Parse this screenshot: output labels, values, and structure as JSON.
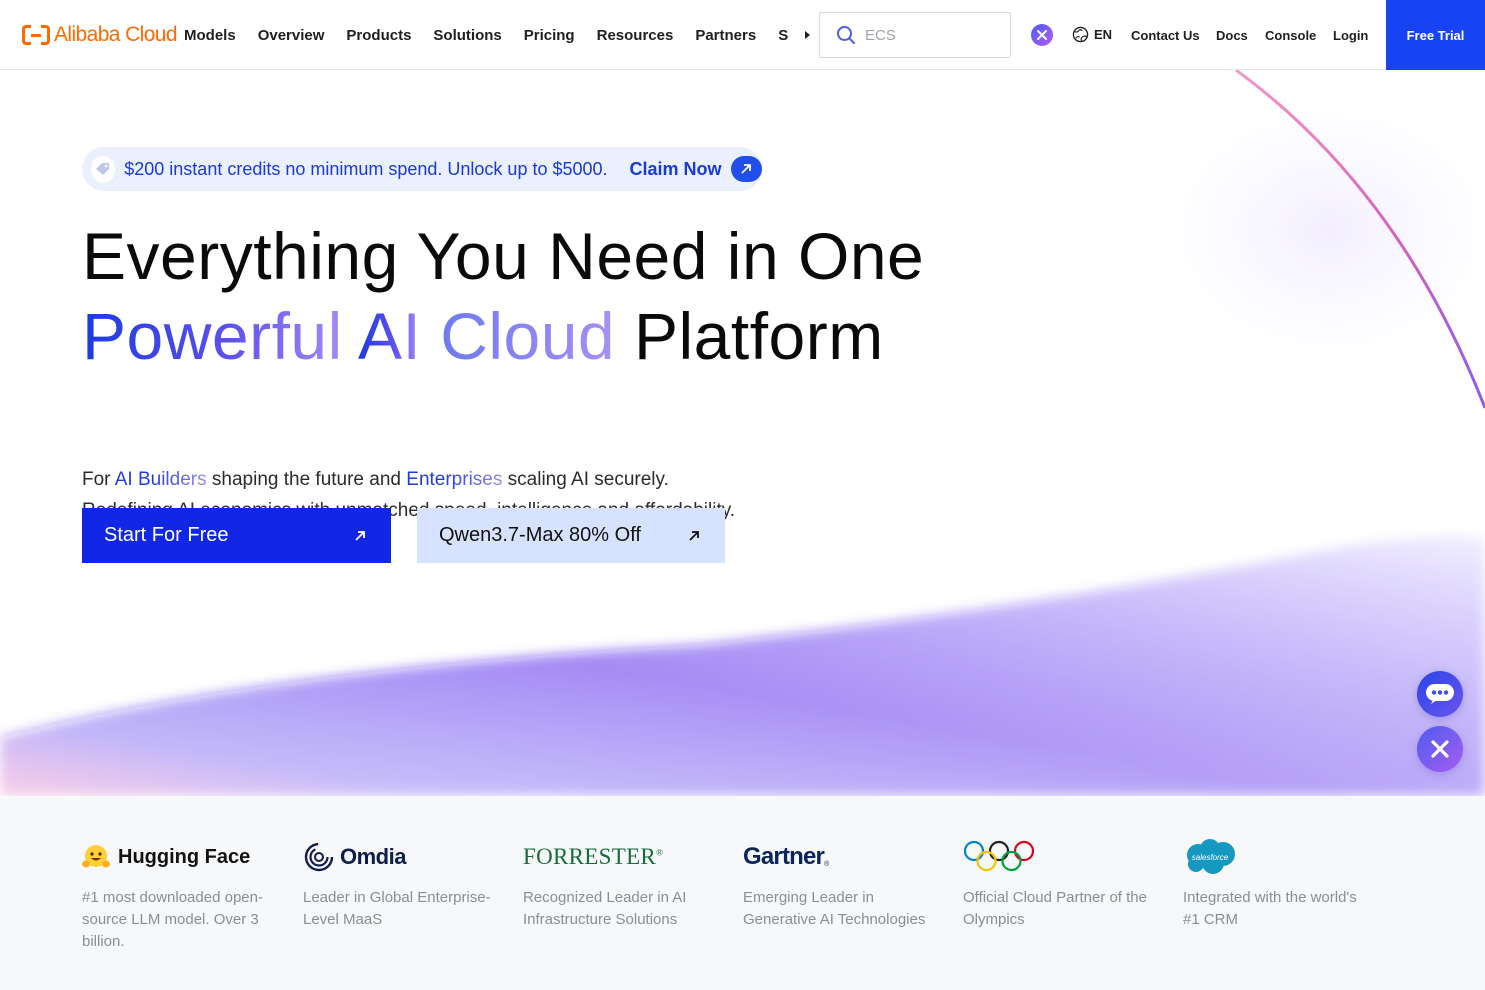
{
  "header": {
    "logo_text": "Alibaba Cloud",
    "nav": [
      "Models",
      "Overview",
      "Products",
      "Solutions",
      "Pricing",
      "Resources",
      "Partners"
    ],
    "nav_more": "S",
    "search": {
      "placeholder": "ECS",
      "icon": "search-icon"
    },
    "lang": "EN",
    "links": {
      "contact": "Contact Us",
      "docs": "Docs",
      "console": "Console",
      "login": "Login"
    },
    "free_trial": "Free Trial"
  },
  "hero": {
    "promo": {
      "text": "$200 instant credits no minimum spend. Unlock up to $5000.",
      "cta": "Claim Now"
    },
    "headline": {
      "line1": "Everything You Need in One",
      "line2_a": "Powerful",
      "line2_b": "AI",
      "line2_c": "Cloud",
      "line2_d": "Platform"
    },
    "sub": {
      "for": "For",
      "builders": "AI Builders",
      "mid": "shaping the future and",
      "enterprises": "Enterprises",
      "end": "scaling AI securely.",
      "line2": "Redefining AI economics with unmatched speed, intelligence and affordability."
    },
    "primary_button": "Start For Free",
    "secondary_button": "Qwen3.7-Max 80% Off"
  },
  "partners": [
    {
      "name": "Hugging Face",
      "desc": "#1 most downloaded open-source LLM model. Over 3 billion."
    },
    {
      "name": "Omdia",
      "desc": "Leader in Global Enterprise-Level MaaS"
    },
    {
      "name": "FORRESTER",
      "desc": "Recognized Leader in AI Infrastructure Solutions"
    },
    {
      "name": "Gartner",
      "desc": "Emerging Leader in Generative AI Technologies"
    },
    {
      "name": "Olympics",
      "desc": "Official Cloud Partner of the Olympics"
    },
    {
      "name": "salesforce",
      "desc": "Integrated with the world's #1 CRM"
    }
  ],
  "colors": {
    "brand_orange": "#ff6a00",
    "primary_blue": "#1226e6",
    "trial_blue": "#1843f5",
    "secondary_bg": "#d7e3fe"
  }
}
